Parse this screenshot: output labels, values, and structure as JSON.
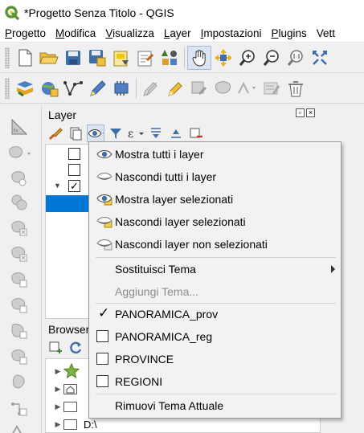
{
  "window": {
    "title": "*Progetto Senza Titolo - QGIS"
  },
  "menubar": {
    "items": [
      {
        "underline": "P",
        "rest": "rogetto"
      },
      {
        "underline": "M",
        "rest": "odifica"
      },
      {
        "underline": "V",
        "rest": "isualizza"
      },
      {
        "underline": "L",
        "rest": "ayer"
      },
      {
        "underline": "I",
        "rest": "mpostazioni"
      },
      {
        "underline": "P",
        "rest": "lugins"
      },
      {
        "underline": "",
        "rest": "Vett"
      }
    ]
  },
  "layer_panel": {
    "title": "Layer"
  },
  "browser_panel": {
    "title": "Browser",
    "items": [
      "D:\\"
    ]
  },
  "popup_menu": {
    "items": [
      {
        "label": "Mostra tutti i layer",
        "icon": "eye-icon"
      },
      {
        "label": "Nascondi tutti i layer",
        "icon": "eye-closed-icon"
      },
      {
        "label": "Mostra layer selezionati",
        "icon": "eye-selected-icon"
      },
      {
        "label": "Nascondi layer selezionati",
        "icon": "eye-closed-selected-icon"
      },
      {
        "label": "Nascondi layer non selezionati",
        "icon": "eye-closed-icon"
      },
      {
        "label": "Sostituisci Tema",
        "submenu": true
      },
      {
        "label": "Aggiungi Tema...",
        "disabled": true
      },
      {
        "label": "PANORAMICA_prov",
        "checked": true
      },
      {
        "label": "PANORAMICA_reg",
        "checked": false
      },
      {
        "label": "PROVINCE",
        "checked": false
      },
      {
        "label": "REGIONI",
        "checked": false
      },
      {
        "label": "Rimuovi Tema Attuale"
      }
    ]
  },
  "colors": {
    "selection": "#0078d7",
    "qgis_green": "#589632",
    "qgis_yellow": "#eec900"
  }
}
